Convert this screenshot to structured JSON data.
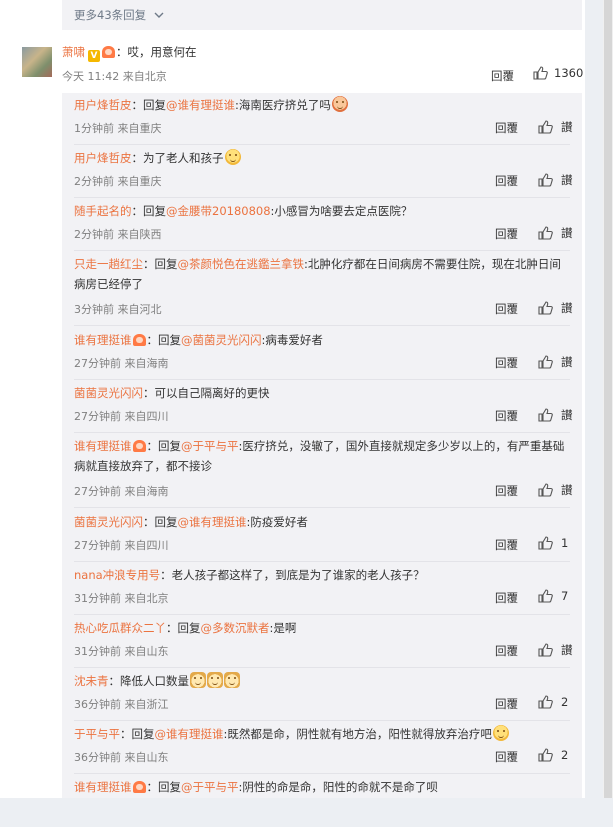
{
  "more_replies": {
    "label": "更多43条回复"
  },
  "main_comment": {
    "username": "萧啸",
    "text": "：哎，用意何在",
    "meta": "今天 11:42 来自北京",
    "reply_label": "回覆",
    "likes": "1360"
  },
  "replies": [
    {
      "user": "用户烽哲皮",
      "prefix": "：回复",
      "mention": "@谁有理挺谁",
      "text": ":海南医疗挤兑了吗",
      "emoji": "red",
      "meta": "1分钟前 来自重庆",
      "reply_label": "回覆",
      "likes": "讃"
    },
    {
      "user": "用户烽哲皮",
      "prefix": "：为了老人和孩子",
      "mention": "",
      "text": "",
      "emoji": "yellow",
      "meta": "2分钟前 来自重庆",
      "reply_label": "回覆",
      "likes": "讃"
    },
    {
      "user": "随手起名的",
      "prefix": "：回复",
      "mention": "@金腰带20180808",
      "text": ":小感冒为啥要去定点医院？",
      "emoji": "",
      "meta": "2分钟前 来自陕西",
      "reply_label": "回覆",
      "likes": "讃"
    },
    {
      "user": "只走一趟红尘",
      "prefix": "：回复",
      "mention": "@茶颜悦色在逃鑑兰拿铁",
      "text": ":北肿化疗都在日间病房不需要住院，现在北肿日间病房已经停了",
      "emoji": "",
      "meta": "3分钟前 来自河北",
      "reply_label": "回覆",
      "likes": "讃"
    },
    {
      "user": "谁有理挺谁",
      "prefix": "：回复",
      "mention": "@菌菌灵光闪闪",
      "text": ":病毒爱好者",
      "emoji": "",
      "badge": true,
      "meta": "27分钟前 来自海南",
      "reply_label": "回覆",
      "likes": "讃"
    },
    {
      "user": "菌菌灵光闪闪",
      "prefix": "：可以自己隔离好的更快",
      "mention": "",
      "text": "",
      "emoji": "",
      "meta": "27分钟前 来自四川",
      "reply_label": "回覆",
      "likes": "讃"
    },
    {
      "user": "谁有理挺谁",
      "prefix": "：回复",
      "mention": "@于平与平",
      "text": ":医疗挤兑，没辙了，国外直接就规定多少岁以上的，有严重基础病就直接放弃了，都不接诊",
      "emoji": "",
      "badge": true,
      "meta": "27分钟前 来自海南",
      "reply_label": "回覆",
      "likes": "讃"
    },
    {
      "user": "菌菌灵光闪闪",
      "prefix": "：回复",
      "mention": "@谁有理挺谁",
      "text": ":防疫爱好者",
      "emoji": "",
      "meta": "27分钟前 来自四川",
      "reply_label": "回覆",
      "likes": "1"
    },
    {
      "user": "nana冲浪专用号",
      "prefix": "：老人孩子都这样了，到底是为了谁家的老人孩子？",
      "mention": "",
      "text": "",
      "emoji": "",
      "meta": "31分钟前 来自北京",
      "reply_label": "回覆",
      "likes": "7"
    },
    {
      "user": "热心吃瓜群众二丫",
      "prefix": "：回复",
      "mention": "@多数沉默者",
      "text": ":是啊",
      "emoji": "",
      "meta": "31分钟前 来自山东",
      "reply_label": "回覆",
      "likes": "讃"
    },
    {
      "user": "沈未青",
      "prefix": "：降低人口数量",
      "mention": "",
      "text": "",
      "emoji": "dogs",
      "meta": "36分钟前 来自浙江",
      "reply_label": "回覆",
      "likes": "2"
    },
    {
      "user": "于平与平",
      "prefix": "：回复",
      "mention": "@谁有理挺谁",
      "text": ":既然都是命，阴性就有地方治，阳性就得放弃治疗吧",
      "emoji": "yellow",
      "meta": "36分钟前 来自山东",
      "reply_label": "回覆",
      "likes": "2"
    },
    {
      "user": "谁有理挺谁",
      "prefix": "：回复",
      "mention": "@于平与平",
      "text": ":阴性的命是命，阳性的命就不是命了呗",
      "emoji": "",
      "badge": true,
      "meta": "",
      "reply_label": "",
      "likes": ""
    }
  ]
}
